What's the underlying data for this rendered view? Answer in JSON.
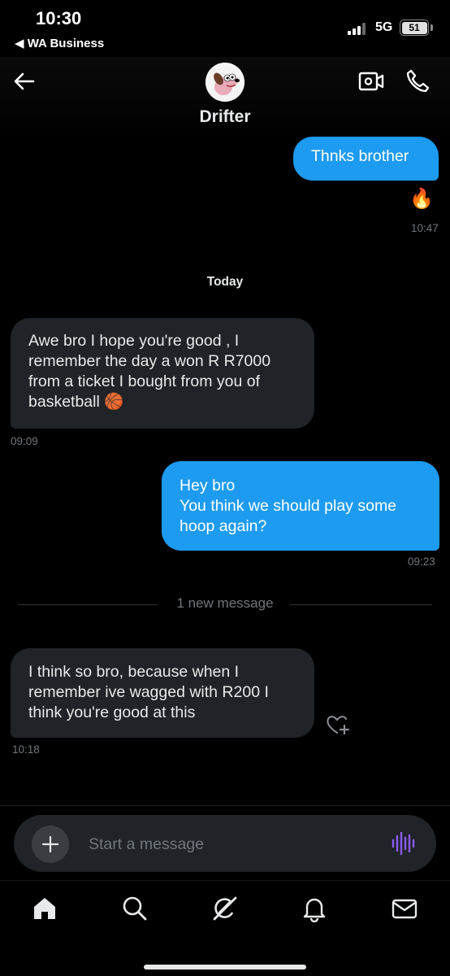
{
  "status_bar": {
    "time": "10:30",
    "back_app": "◀ WA Business",
    "network": "5G",
    "battery": "51"
  },
  "header": {
    "contact_name": "Drifter",
    "back_icon": "arrow-left-icon",
    "video_icon": "video-camera-icon",
    "call_icon": "phone-icon"
  },
  "messages": [
    {
      "direction": "out",
      "text": "Thnks brother",
      "reaction": "🔥",
      "time": "10:47"
    },
    {
      "direction": "in",
      "text": "Awe bro I hope you're good , I remember the day a won R R7000 from a ticket I bought from you of basketball 🏀",
      "time": "09:09"
    },
    {
      "direction": "out",
      "text": "Hey bro\nYou think we should play some hoop again?",
      "time": "09:23"
    },
    {
      "direction": "in",
      "text": "I think so bro, because when I remember ive wagged with R200 I think you're good at this",
      "time": "10:18"
    }
  ],
  "separators": {
    "day": "Today",
    "new_message": "1 new message"
  },
  "composer": {
    "placeholder": "Start a message"
  },
  "tabs": [
    {
      "name": "home",
      "icon": "home-icon",
      "active": true
    },
    {
      "name": "search",
      "icon": "search-icon"
    },
    {
      "name": "grok",
      "icon": "slash-circle-icon"
    },
    {
      "name": "notifications",
      "icon": "bell-icon"
    },
    {
      "name": "messages",
      "icon": "envelope-icon"
    }
  ],
  "colors": {
    "outgoing_bubble": "#1d9bf0",
    "incoming_bubble": "#202327",
    "voice_accent": "#8b5cf6",
    "background": "#000000"
  }
}
